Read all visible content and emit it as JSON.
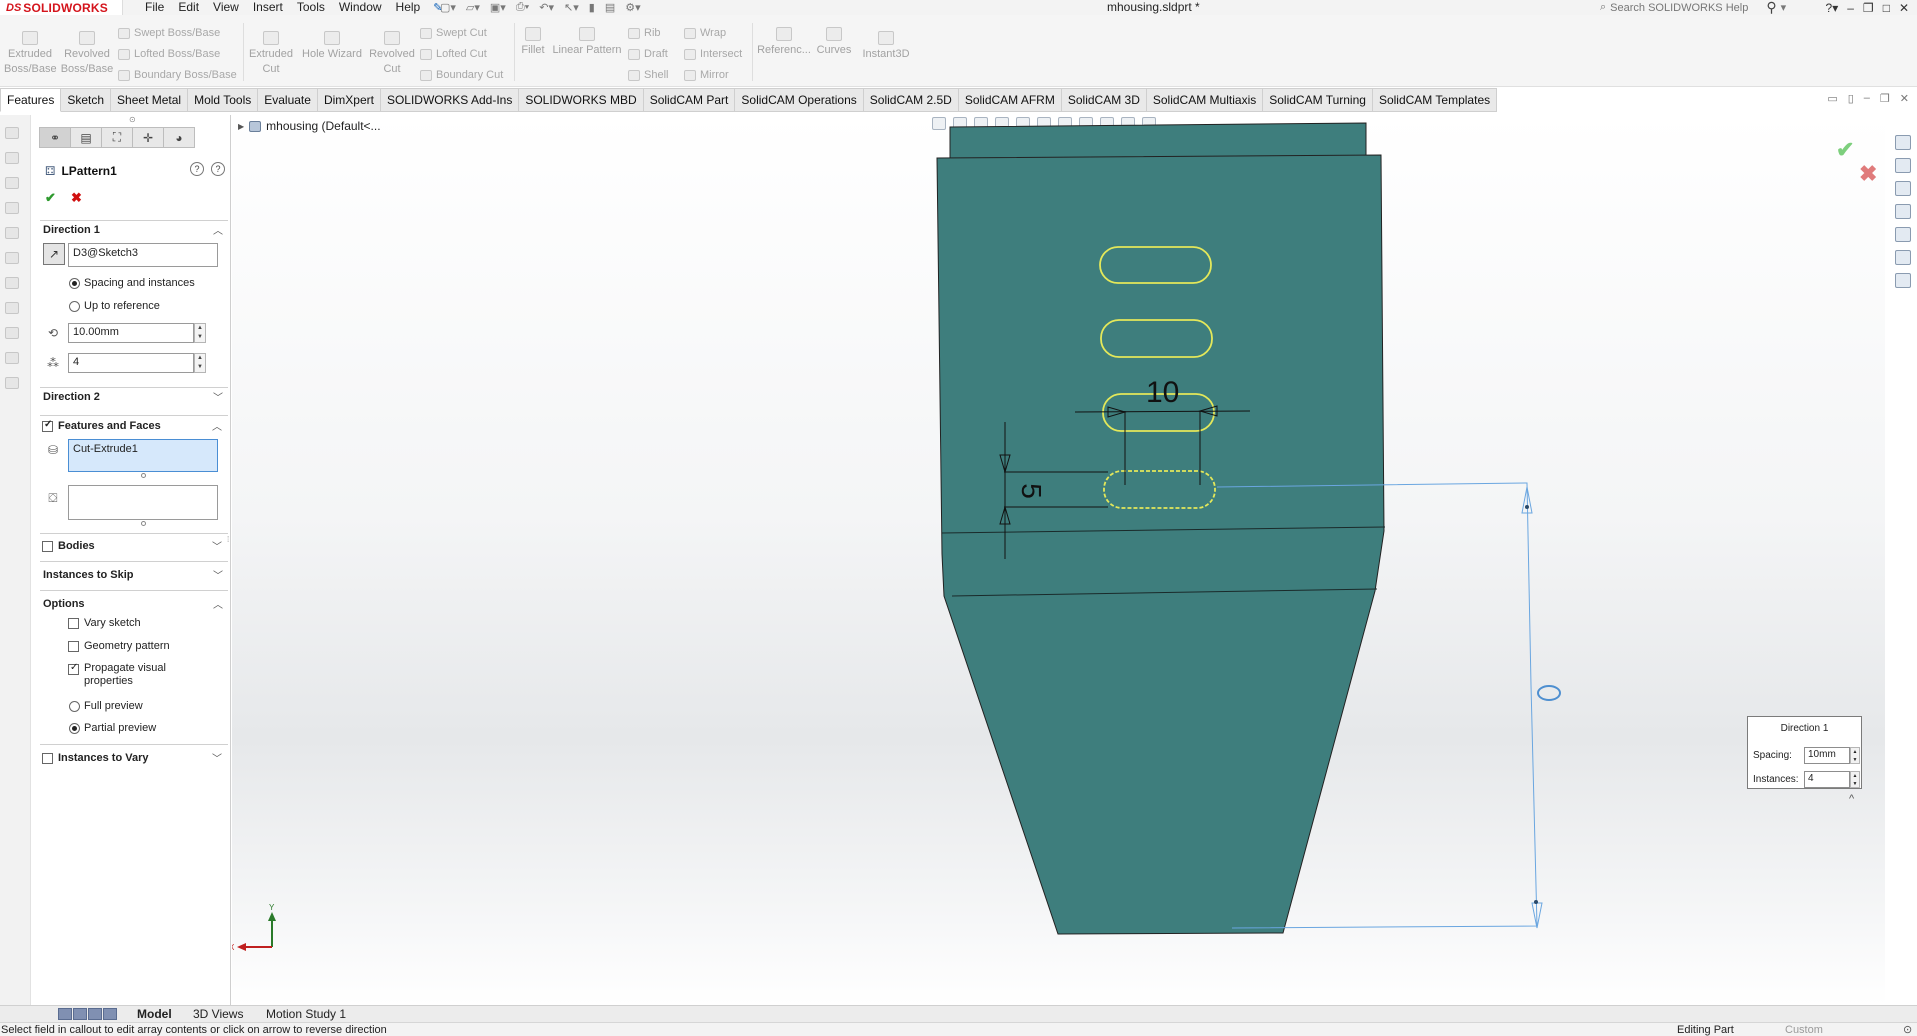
{
  "app": {
    "logo_prefix": "DS",
    "brand": "SOLIDWORKS",
    "document_title": "mhousing.sldprt *",
    "search_placeholder": "Search SOLIDWORKS Help"
  },
  "menus": [
    "File",
    "Edit",
    "View",
    "Insert",
    "Tools",
    "Window",
    "Help"
  ],
  "ribbon": {
    "extruded_boss": "Extruded Boss/Base",
    "revolved_boss": "Revolved Boss/Base",
    "swept_boss": "Swept Boss/Base",
    "lofted_boss": "Lofted Boss/Base",
    "boundary_boss": "Boundary Boss/Base",
    "extruded_cut": "Extruded Cut",
    "hole_wizard": "Hole Wizard",
    "revolved_cut": "Revolved Cut",
    "swept_cut": "Swept Cut",
    "lofted_cut": "Lofted Cut",
    "boundary_cut": "Boundary Cut",
    "fillet": "Fillet",
    "linear_pattern": "Linear Pattern",
    "rib": "Rib",
    "draft": "Draft",
    "shell": "Shell",
    "wrap": "Wrap",
    "intersect": "Intersect",
    "mirror": "Mirror",
    "reference": "Referenc...",
    "curves": "Curves",
    "instant3d": "Instant3D"
  },
  "command_tabs": [
    "Features",
    "Sketch",
    "Sheet Metal",
    "Mold Tools",
    "Evaluate",
    "DimXpert",
    "SOLIDWORKS Add-Ins",
    "SOLIDWORKS MBD",
    "SolidCAM Part",
    "SolidCAM Operations",
    "SolidCAM 2.5D",
    "SolidCAM AFRM",
    "SolidCAM 3D",
    "SolidCAM Multiaxis",
    "SolidCAM Turning",
    "SolidCAM Templates"
  ],
  "property_manager": {
    "title": "LPattern1",
    "direction1": {
      "label": "Direction 1",
      "reference": "D3@Sketch3",
      "spacing_and_instances": "Spacing and instances",
      "up_to_reference": "Up to reference",
      "spacing": "10.00mm",
      "instances": "4"
    },
    "direction2": {
      "label": "Direction 2"
    },
    "features_and_faces": {
      "label": "Features and Faces",
      "feature": "Cut-Extrude1",
      "faces": ""
    },
    "bodies": {
      "label": "Bodies"
    },
    "instances_to_skip": {
      "label": "Instances to Skip"
    },
    "options": {
      "label": "Options",
      "vary_sketch": "Vary sketch",
      "geometry_pattern": "Geometry pattern",
      "propagate_visual": "Propagate visual properties",
      "full_preview": "Full preview",
      "partial_preview": "Partial preview"
    },
    "instances_to_vary": {
      "label": "Instances to Vary"
    }
  },
  "viewport": {
    "tree_root": "mhousing  (Default<...",
    "part_color": "#3e7e7d",
    "slot_color": "#e4e85a",
    "dim_horizontal": "10",
    "dim_vertical": "5",
    "axis_x": "X",
    "axis_y": "Y"
  },
  "callout": {
    "title": "Direction 1",
    "spacing_label": "Spacing:",
    "spacing_value": "10mm",
    "instances_label": "Instances:",
    "instances_value": "4"
  },
  "bottom_tabs": [
    "Model",
    "3D Views",
    "Motion Study 1"
  ],
  "status": {
    "message": "Select field in callout to edit array contents or click on arrow to reverse direction",
    "mode": "Editing Part",
    "units": "Custom"
  }
}
